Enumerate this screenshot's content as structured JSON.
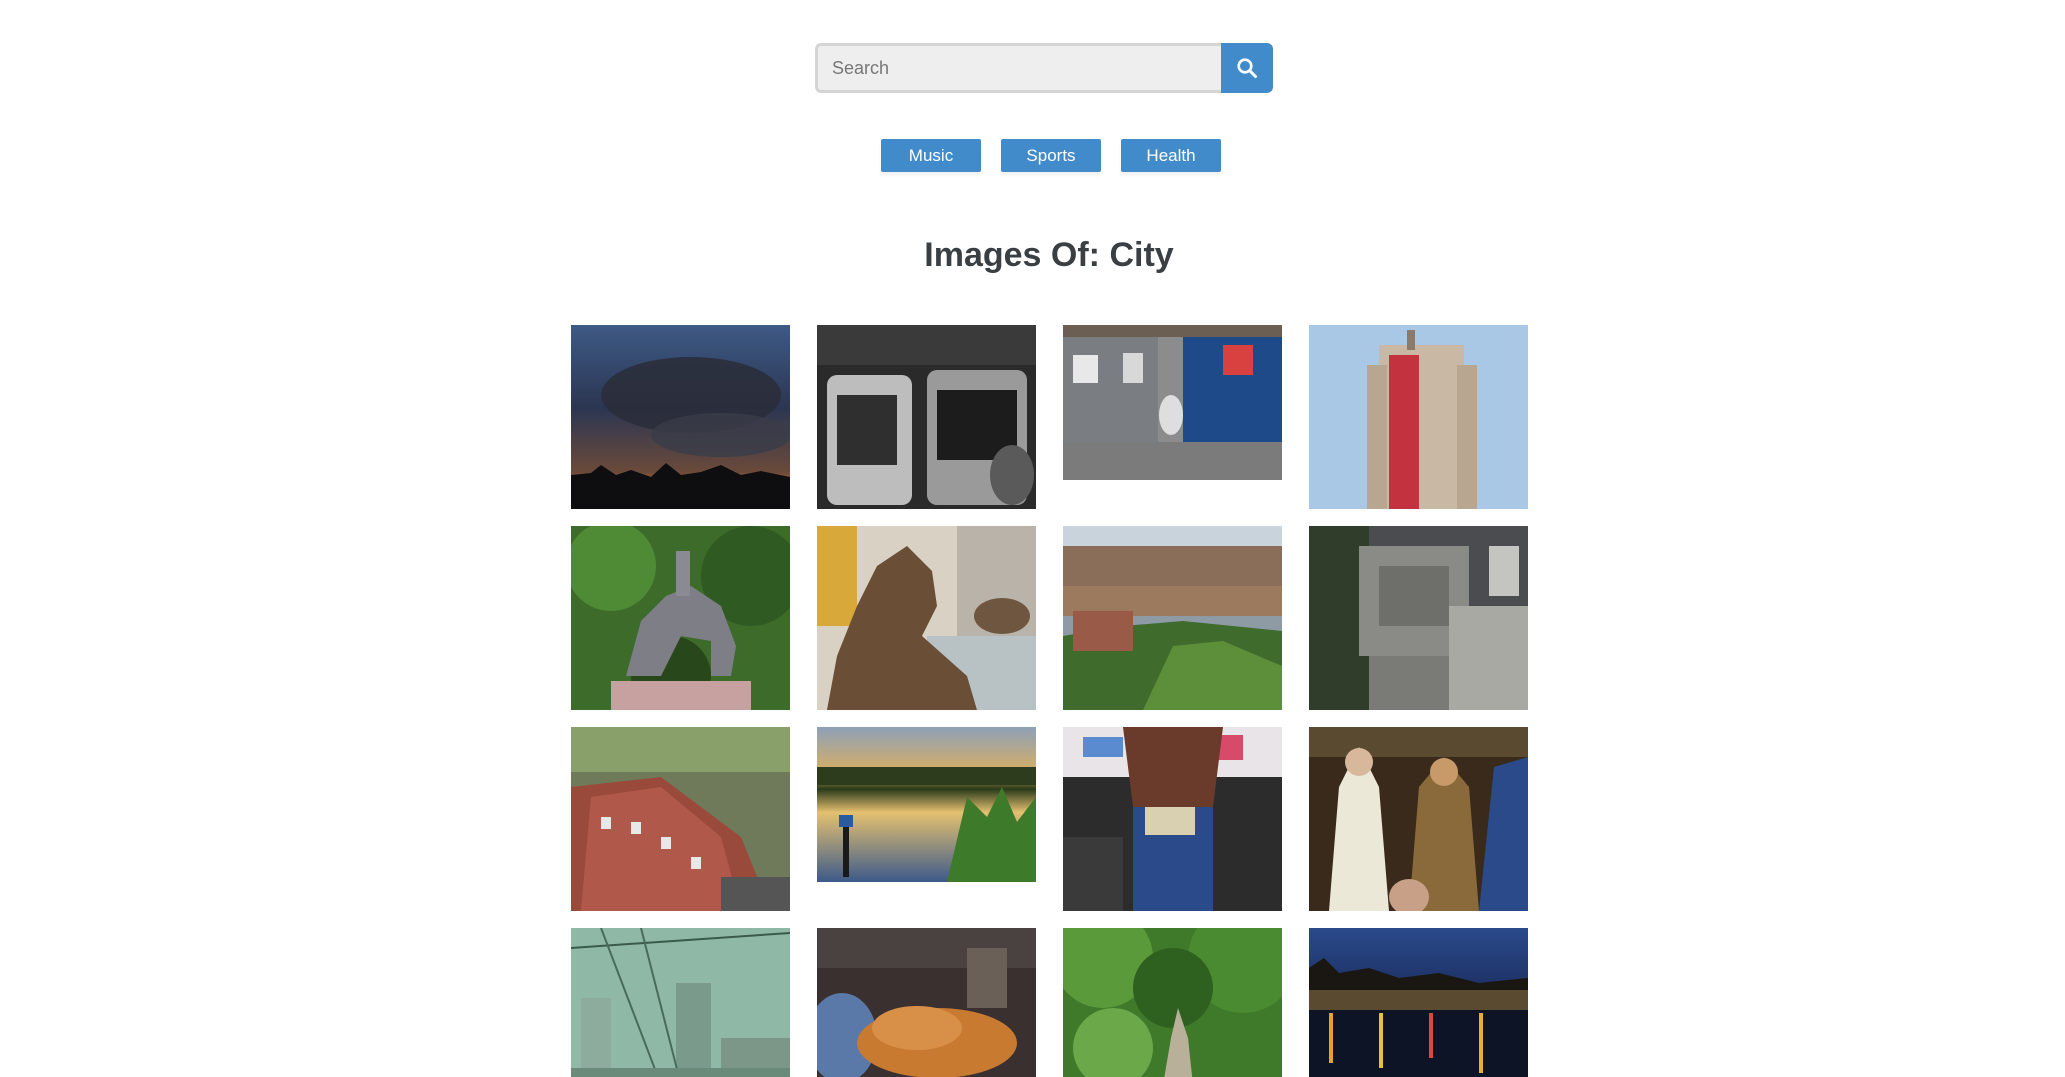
{
  "search": {
    "placeholder": "Search",
    "value": "",
    "button_icon": "search-icon"
  },
  "categories": [
    {
      "label": "Music"
    },
    {
      "label": "Sports"
    },
    {
      "label": "Health"
    }
  ],
  "heading": "Images Of: City",
  "colors": {
    "accent": "#428bca",
    "title": "#3a3f44"
  },
  "gallery": {
    "images": [
      {
        "subject": "city skyline at sunset with dark clouds"
      },
      {
        "subject": "black and white subway car interior"
      },
      {
        "subject": "dumpsters with a toilet in between"
      },
      {
        "subject": "tall hotel tower with red banner"
      },
      {
        "subject": "equestrian statue among trees"
      },
      {
        "subject": "bronze lion statue by steps"
      },
      {
        "subject": "aerial view of city and park"
      },
      {
        "subject": "aerial view of building rooftops"
      },
      {
        "subject": "aerial view of red brick building"
      },
      {
        "subject": "river at sunset with reeds"
      },
      {
        "subject": "person holding dollar bills"
      },
      {
        "subject": "religious statues behind glass"
      },
      {
        "subject": "city towers seen through cables"
      },
      {
        "subject": "dog sleeping on a train"
      },
      {
        "subject": "green garden path"
      },
      {
        "subject": "waterfront city at night"
      }
    ]
  }
}
